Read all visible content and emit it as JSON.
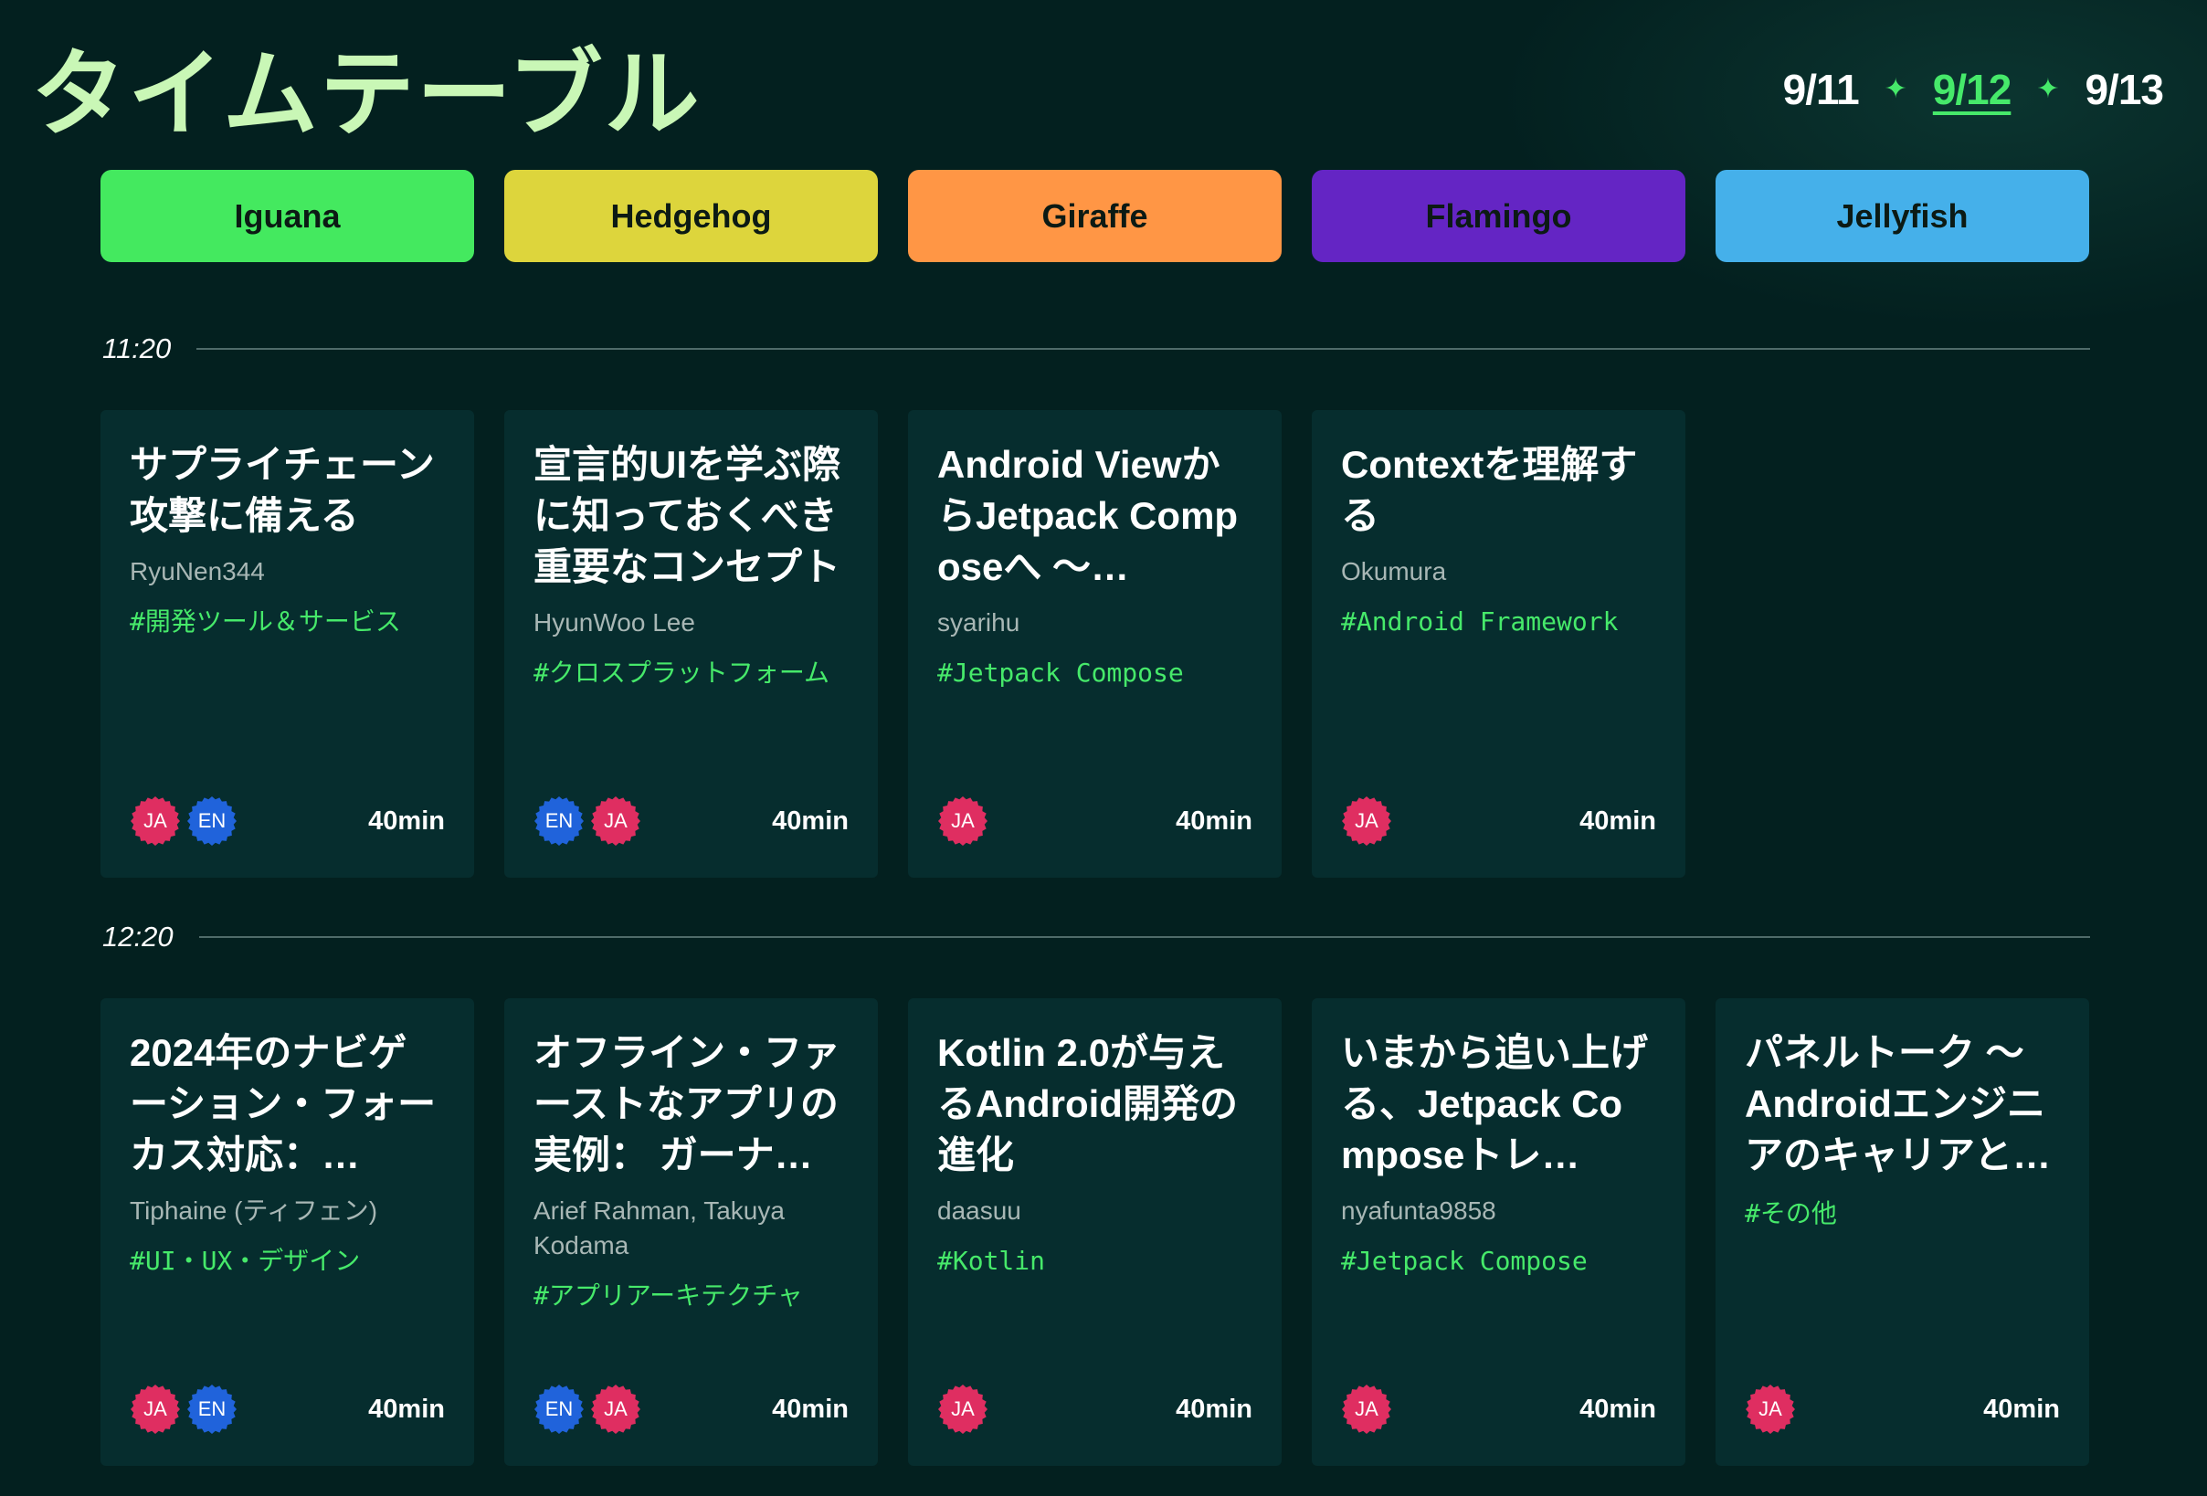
{
  "header": {
    "title": "タイムテーブル",
    "dates": [
      "9/11",
      "9/12",
      "9/13"
    ],
    "active_date_index": 1
  },
  "rooms": [
    {
      "name": "Iguana",
      "color": "#44e95f"
    },
    {
      "name": "Hedgehog",
      "color": "#ddd53c"
    },
    {
      "name": "Giraffe",
      "color": "#ff9645"
    },
    {
      "name": "Flamingo",
      "color": "#6425c4"
    },
    {
      "name": "Jellyfish",
      "color": "#45b0ea"
    }
  ],
  "lang_colors": {
    "JA": "#df2e61",
    "EN": "#2063db"
  },
  "slots": [
    {
      "time": "11:20",
      "sessions": [
        {
          "title": "サプライチェーン攻撃に備える",
          "speaker": "RyuNen344",
          "tag": "#開発ツール＆サービス",
          "langs": [
            "JA",
            "EN"
          ],
          "duration": "40min"
        },
        {
          "title": "宣言的UIを学ぶ際に知っておくべき重要なコンセプト",
          "speaker": "HyunWoo Lee",
          "tag": "#クロスプラットフォーム",
          "langs": [
            "EN",
            "JA"
          ],
          "duration": "40min"
        },
        {
          "title": "Android ViewからJetpack Composeへ 〜…",
          "speaker": "syarihu",
          "tag": "#Jetpack Compose",
          "langs": [
            "JA"
          ],
          "duration": "40min"
        },
        {
          "title": "Contextを理解する",
          "speaker": "Okumura",
          "tag": "#Android Framework",
          "langs": [
            "JA"
          ],
          "duration": "40min"
        }
      ]
    },
    {
      "time": "12:20",
      "sessions": [
        {
          "title": "2024年のナビゲーション・フォーカス対応：…",
          "speaker": "Tiphaine (ティフェン)",
          "tag": "#UI・UX・デザイン",
          "langs": [
            "JA",
            "EN"
          ],
          "duration": "40min"
        },
        {
          "title": "オフライン・ファーストなアプリの実例： ガーナの…",
          "speaker": "Arief Rahman, Takuya Kodama",
          "tag": "#アプリアーキテクチャ",
          "langs": [
            "EN",
            "JA"
          ],
          "duration": "40min"
        },
        {
          "title": "Kotlin 2.0が与えるAndroid開発の進化",
          "speaker": "daasuu",
          "tag": "#Kotlin",
          "langs": [
            "JA"
          ],
          "duration": "40min"
        },
        {
          "title": "いまから追い上げる、Jetpack Composeトレ…",
          "speaker": "nyafunta9858",
          "tag": "#Jetpack Compose",
          "langs": [
            "JA"
          ],
          "duration": "40min"
        },
        {
          "title": "パネルトーク 〜 Androidエンジニアのキャリアと…",
          "speaker": "",
          "tag": "#その他",
          "langs": [
            "JA"
          ],
          "duration": "40min"
        }
      ]
    }
  ]
}
